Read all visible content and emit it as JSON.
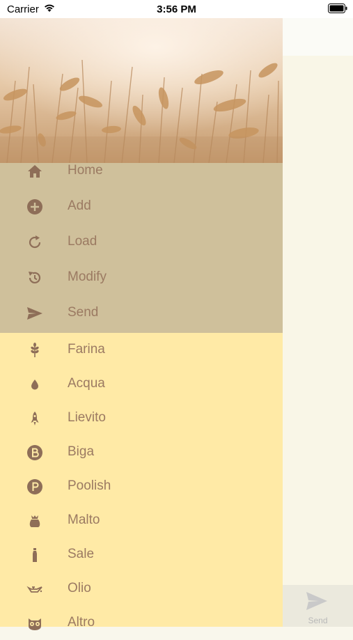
{
  "status_bar": {
    "carrier": "Carrier",
    "time": "3:56 PM"
  },
  "menu": {
    "main_items": [
      {
        "label": "Home",
        "icon": "home-icon"
      },
      {
        "label": "Add",
        "icon": "add-circle-icon"
      },
      {
        "label": "Load",
        "icon": "reload-icon"
      },
      {
        "label": "Modify",
        "icon": "history-icon"
      },
      {
        "label": "Send",
        "icon": "send-icon"
      }
    ],
    "ingredient_items": [
      {
        "label": "Farina",
        "icon": "wheat-icon"
      },
      {
        "label": "Acqua",
        "icon": "water-drop-icon"
      },
      {
        "label": "Lievito",
        "icon": "rocket-icon"
      },
      {
        "label": "Biga",
        "icon": "letter-b-icon"
      },
      {
        "label": "Poolish",
        "icon": "letter-p-icon"
      },
      {
        "label": "Malto",
        "icon": "sack-icon"
      },
      {
        "label": "Sale",
        "icon": "salt-shaker-icon"
      },
      {
        "label": "Olio",
        "icon": "oil-can-icon"
      },
      {
        "label": "Altro",
        "icon": "owl-icon"
      }
    ]
  },
  "bottom_bar": {
    "send_label": "Send"
  },
  "colors": {
    "main_menu_bg": "#cfc09b",
    "ingredient_bg": "#ffeaa6",
    "text": "#9b7a62",
    "icon": "#8e6e58"
  }
}
